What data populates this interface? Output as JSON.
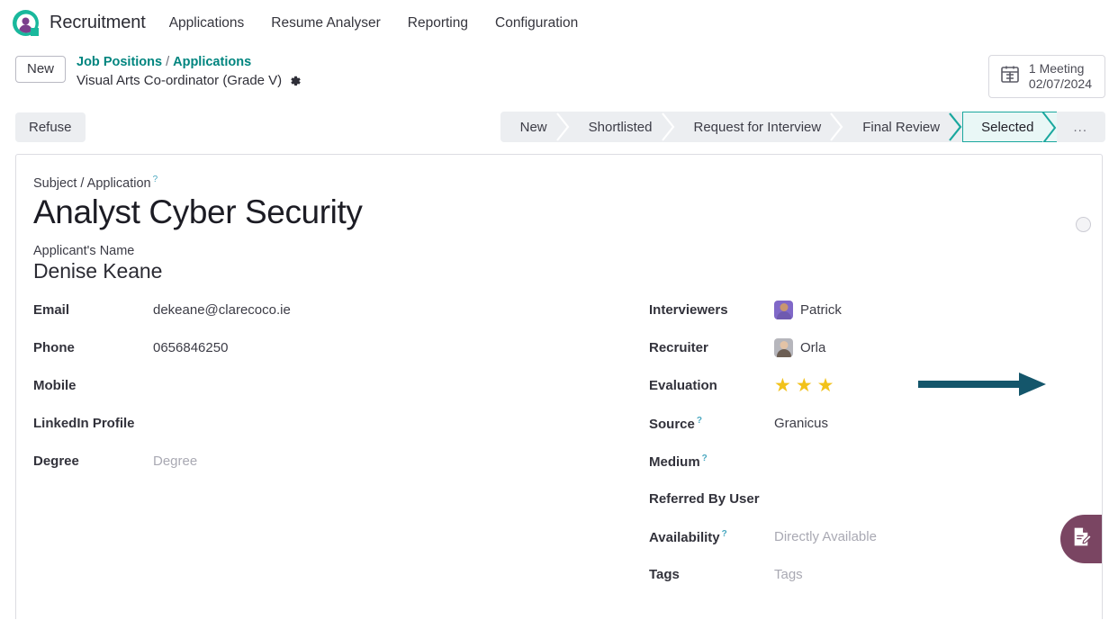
{
  "navbar": {
    "brand": "Recruitment",
    "logo_icon": "recruitment-logo-icon",
    "items": [
      {
        "label": "Applications"
      },
      {
        "label": "Resume Analyser"
      },
      {
        "label": "Reporting"
      },
      {
        "label": "Configuration"
      }
    ]
  },
  "breadcrumb": {
    "new_badge": "New",
    "parent": "Job Positions",
    "separator": "/",
    "child": "Applications",
    "record": "Visual Arts Co-ordinator (Grade V)",
    "settings_icon": "gear-icon"
  },
  "meeting": {
    "icon": "calendar-icon",
    "count_label": "1 Meeting",
    "date": "02/07/2024"
  },
  "actions": {
    "refuse": "Refuse"
  },
  "statusbar": {
    "stages": [
      {
        "label": "New",
        "current": false
      },
      {
        "label": "Shortlisted",
        "current": false
      },
      {
        "label": "Request for Interview",
        "current": false
      },
      {
        "label": "Final Review",
        "current": false
      },
      {
        "label": "Selected",
        "current": true
      }
    ],
    "overflow_label": "...",
    "active_color": "#1aa79e",
    "active_bg": "#e9f7f6",
    "bar_bg": "#eceef1"
  },
  "form": {
    "subject_label": "Subject / Application",
    "subject_help": "?",
    "title": "Analyst Cyber Security",
    "applicant_label": "Applicant's Name",
    "applicant_name": "Denise Keane",
    "priority_icon": "priority-circle-icon",
    "left_fields": [
      {
        "label": "Email",
        "value": "dekeane@clarecoco.ie",
        "placeholder": false,
        "help": false
      },
      {
        "label": "Phone",
        "value": "0656846250",
        "placeholder": false,
        "help": false
      },
      {
        "label": "Mobile",
        "value": "",
        "placeholder": false,
        "help": false
      },
      {
        "label": "LinkedIn Profile",
        "value": "",
        "placeholder": false,
        "help": false
      },
      {
        "label": "Degree",
        "value": "Degree",
        "placeholder": true,
        "help": false
      }
    ],
    "right_fields": [
      {
        "label": "Interviewers",
        "value": "Patrick",
        "type": "person",
        "avatar": "purple",
        "help": false
      },
      {
        "label": "Recruiter",
        "value": "Orla",
        "type": "person",
        "avatar": "grey",
        "help": false
      },
      {
        "label": "Evaluation",
        "value": "",
        "type": "stars",
        "stars": 3,
        "help": false
      },
      {
        "label": "Source",
        "value": "Granicus",
        "type": "text",
        "placeholder": false,
        "help": true
      },
      {
        "label": "Medium",
        "value": "",
        "type": "text",
        "placeholder": false,
        "help": true
      },
      {
        "label": "Referred By User",
        "value": "",
        "type": "text",
        "placeholder": false,
        "help": false
      },
      {
        "label": "Availability",
        "value": "Directly Available",
        "type": "text",
        "placeholder": true,
        "help": true
      },
      {
        "label": "Tags",
        "value": "Tags",
        "type": "text",
        "placeholder": true,
        "help": false
      }
    ]
  },
  "sign_panel": {
    "icon": "document-sign-icon",
    "color": "#7a4562"
  },
  "annotation": {
    "arrow_icon": "pointer-arrow-icon",
    "color": "#14566b"
  }
}
